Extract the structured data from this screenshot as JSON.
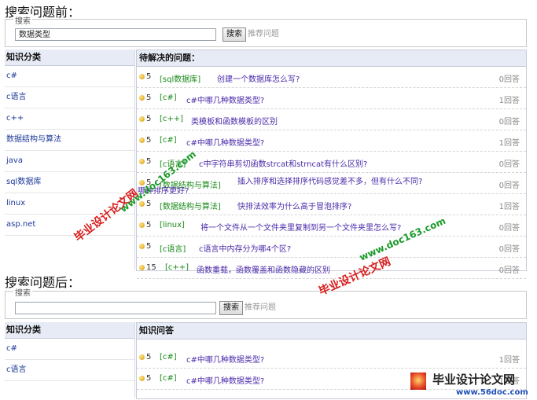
{
  "top": {
    "caption": "搜索问题前：",
    "search": {
      "legend": "搜索",
      "value": "数据类型",
      "button": "搜索",
      "recommend": "推荐问题"
    },
    "categories": {
      "header": "知识分类",
      "items": [
        "c#",
        "c语言",
        "c++",
        "数据结构与算法",
        "java",
        "sql数据库",
        "linux",
        "asp.net"
      ]
    },
    "questions": {
      "header": "待解决的问题：",
      "rows": [
        {
          "score": "5",
          "cat": "[sql数据库]",
          "title": "创建一个数据库怎么写?",
          "answers": "0回答"
        },
        {
          "score": "5",
          "cat": "[c#]",
          "title": "c#中哪几种数据类型?",
          "answers": "1回答"
        },
        {
          "score": "5",
          "cat": "[c++]",
          "title": "类模板和函数模板的区别",
          "answers": "0回答"
        },
        {
          "score": "5",
          "cat": "[c#]",
          "title": "c#中哪几种数据类型?",
          "answers": "1回答"
        },
        {
          "score": "5",
          "cat": "[c语言]",
          "title": "c中字符串剪切函数strcat和strncat有什么区别?",
          "answers": "0回答"
        },
        {
          "score": "5",
          "cat": "[数据结构与算法]",
          "title": "插入排序和选择排序代码感觉差不多，但有什么不同?",
          "title2": "哪种排序更好?",
          "answers": "0回答"
        },
        {
          "score": "5",
          "cat": "[数据结构与算法]",
          "title": "快排法效率为什么高于冒泡排序?",
          "answers": "1回答"
        },
        {
          "score": "5",
          "cat": "[linux]",
          "title": "将一个文件从一个文件夹里复制到另一个文件夹里怎么写?",
          "answers": "0回答"
        },
        {
          "score": "5",
          "cat": "[c语言]",
          "title": "c语言中内存分为哪4个区?",
          "answers": "0回答"
        },
        {
          "score": "15",
          "cat": "[c++]",
          "title": "函数重载，函数覆盖和函数隐藏的区别",
          "answers": "0回答"
        }
      ]
    }
  },
  "bottom": {
    "caption": "搜索问题后：",
    "search": {
      "legend": "搜索",
      "value": "",
      "button": "搜索",
      "recommend": "推荐问题"
    },
    "categories": {
      "header": "知识分类",
      "items": [
        "c#",
        "c语言"
      ]
    },
    "questions": {
      "header": "知识问答",
      "rows": [
        {
          "score": "5",
          "cat": "[c#]",
          "title": "c#中哪几种数据类型?",
          "answers": "1回答"
        },
        {
          "score": "5",
          "cat": "[c#]",
          "title": "c#中哪几种数据类型?",
          "answers": "1回答"
        }
      ]
    }
  },
  "watermarks": {
    "cn": "毕业设计论文网",
    "url": "www.doc163.com",
    "brand_cn": "毕业设计论文网",
    "brand_url": "www.56doc.com"
  }
}
